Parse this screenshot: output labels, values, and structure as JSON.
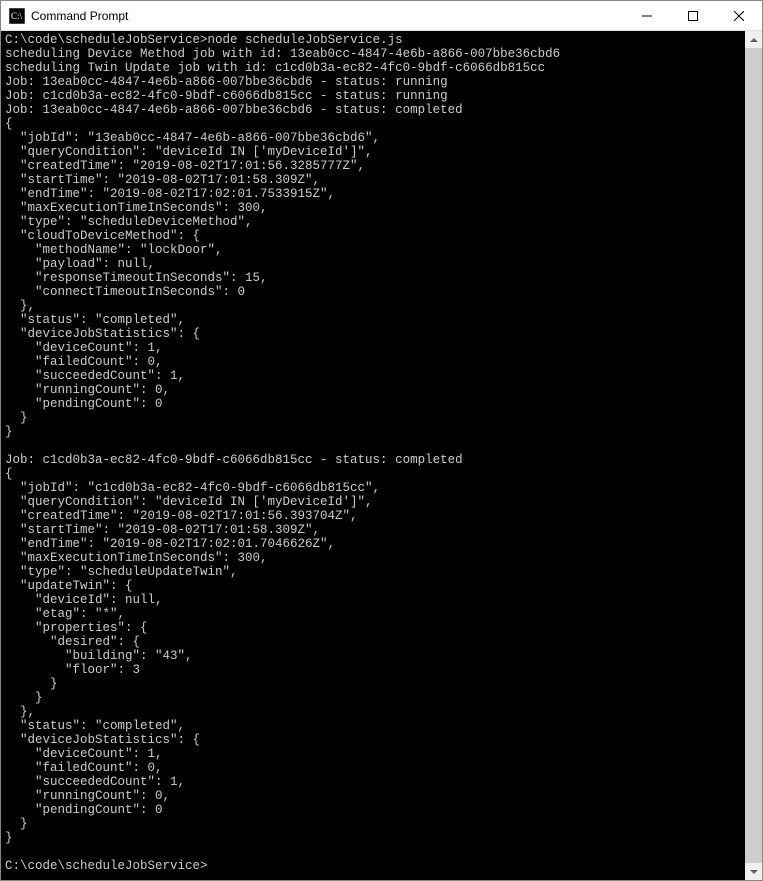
{
  "window": {
    "title": "Command Prompt"
  },
  "console": {
    "prompt1": "C:\\code\\scheduleJobService>",
    "command1": "node scheduleJobService.js",
    "line_sched_device": "scheduling Device Method job with id: 13eab0cc-4847-4e6b-a866-007bbe36cbd6",
    "line_sched_twin": "scheduling Twin Update job with id: c1cd0b3a-ec82-4fc0-9bdf-c6066db815cc",
    "line_job1_running": "Job: 13eab0cc-4847-4e6b-a866-007bbe36cbd6 - status: running",
    "line_job2_running": "Job: c1cd0b3a-ec82-4fc0-9bdf-c6066db815cc - status: running",
    "line_job1_completed": "Job: 13eab0cc-4847-4e6b-a866-007bbe36cbd6 - status: completed",
    "json1": "{\n  \"jobId\": \"13eab0cc-4847-4e6b-a866-007bbe36cbd6\",\n  \"queryCondition\": \"deviceId IN ['myDeviceId']\",\n  \"createdTime\": \"2019-08-02T17:01:56.3285777Z\",\n  \"startTime\": \"2019-08-02T17:01:58.309Z\",\n  \"endTime\": \"2019-08-02T17:02:01.7533915Z\",\n  \"maxExecutionTimeInSeconds\": 300,\n  \"type\": \"scheduleDeviceMethod\",\n  \"cloudToDeviceMethod\": {\n    \"methodName\": \"lockDoor\",\n    \"payload\": null,\n    \"responseTimeoutInSeconds\": 15,\n    \"connectTimeoutInSeconds\": 0\n  },\n  \"status\": \"completed\",\n  \"deviceJobStatistics\": {\n    \"deviceCount\": 1,\n    \"failedCount\": 0,\n    \"succeededCount\": 1,\n    \"runningCount\": 0,\n    \"pendingCount\": 0\n  }\n}",
    "line_job2_completed": "Job: c1cd0b3a-ec82-4fc0-9bdf-c6066db815cc - status: completed",
    "json2": "{\n  \"jobId\": \"c1cd0b3a-ec82-4fc0-9bdf-c6066db815cc\",\n  \"queryCondition\": \"deviceId IN ['myDeviceId']\",\n  \"createdTime\": \"2019-08-02T17:01:56.393704Z\",\n  \"startTime\": \"2019-08-02T17:01:58.309Z\",\n  \"endTime\": \"2019-08-02T17:02:01.7046626Z\",\n  \"maxExecutionTimeInSeconds\": 300,\n  \"type\": \"scheduleUpdateTwin\",\n  \"updateTwin\": {\n    \"deviceId\": null,\n    \"etag\": \"*\",\n    \"properties\": {\n      \"desired\": {\n        \"building\": \"43\",\n        \"floor\": 3\n      }\n    }\n  },\n  \"status\": \"completed\",\n  \"deviceJobStatistics\": {\n    \"deviceCount\": 1,\n    \"failedCount\": 0,\n    \"succeededCount\": 1,\n    \"runningCount\": 0,\n    \"pendingCount\": 0\n  }\n}",
    "prompt2": "C:\\code\\scheduleJobService>"
  }
}
